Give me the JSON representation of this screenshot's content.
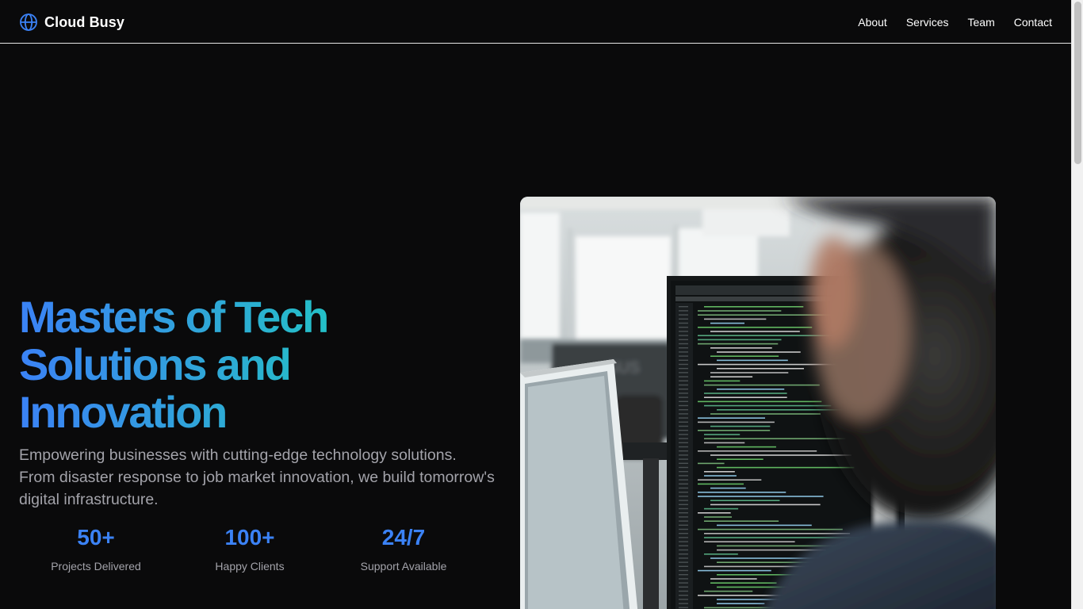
{
  "header": {
    "brand_icon": "globe-icon",
    "brand_name": "Cloud Busy",
    "nav": [
      {
        "label": "About"
      },
      {
        "label": "Services"
      },
      {
        "label": "Team"
      },
      {
        "label": "Contact"
      }
    ]
  },
  "hero": {
    "title": "Masters of Tech Solutions and Innovation",
    "subtitle": "Empowering businesses with cutting-edge technology solutions. From disaster response to job market innovation, we build tomorrow's digital infrastructure.",
    "stats": [
      {
        "value": "50+",
        "label": "Projects Delivered"
      },
      {
        "value": "100+",
        "label": "Happy Clients"
      },
      {
        "value": "24/7",
        "label": "Support Available"
      }
    ],
    "image_description_icon": "photo-developer-at-monitor"
  },
  "colors": {
    "background": "#0a0a0b",
    "accent_blue": "#3b82f6",
    "accent_teal": "#22c4c4",
    "muted_text": "#a3a3aa"
  }
}
